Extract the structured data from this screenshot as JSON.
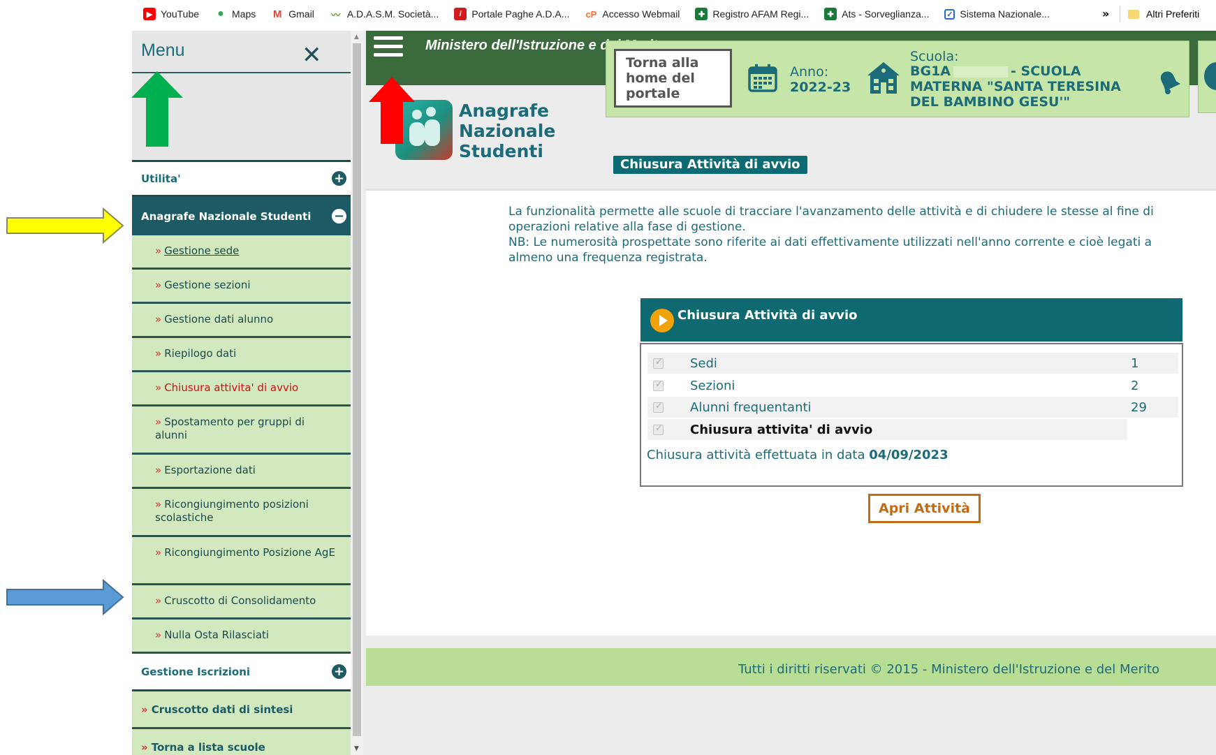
{
  "bookmarks": {
    "items": [
      {
        "label": "YouTube",
        "icon": "youtube-icon",
        "color": "#ff0000"
      },
      {
        "label": "Maps",
        "icon": "maps-icon",
        "color": "#34a853"
      },
      {
        "label": "Gmail",
        "icon": "gmail-icon",
        "color": "#ea4335"
      },
      {
        "label": "A.D.A.S.M. Società...",
        "icon": "chart-icon",
        "color": "#6a9a3a"
      },
      {
        "label": "Portale Paghe A.D.A...",
        "icon": "portale-icon",
        "color": "#d01c1c"
      },
      {
        "label": "Accesso Webmail",
        "icon": "cpanel-icon",
        "color": "#ff6c2c"
      },
      {
        "label": "Registro AFAM Regi...",
        "icon": "registro-icon",
        "color": "#1a7a3a"
      },
      {
        "label": "Ats - Sorveglianza...",
        "icon": "ats-icon",
        "color": "#1a7a3a"
      },
      {
        "label": "Sistema Nazionale...",
        "icon": "checkbox-icon",
        "color": "#2a6ad0"
      }
    ],
    "more": "»",
    "other": "Altri Preferiti"
  },
  "sidebar": {
    "title": "Menu",
    "close": "✕",
    "utilita": "Utilita'",
    "ans": "Anagrafe Nazionale Studenti",
    "items": [
      {
        "label": "Gestione sede"
      },
      {
        "label": "Gestione sezioni"
      },
      {
        "label": "Gestione dati alunno"
      },
      {
        "label": "Riepilogo dati"
      },
      {
        "label": "Chiusura attivita' di avvio"
      },
      {
        "label": "Spostamento per gruppi di alunni"
      },
      {
        "label": "Esportazione dati"
      },
      {
        "label": "Ricongiungimento posizioni scolastiche"
      },
      {
        "label": "Ricongiungimento Posizione AgE"
      },
      {
        "label": "Cruscotto di Consolidamento"
      },
      {
        "label": "Nulla Osta Rilasciati"
      }
    ],
    "raquo": "»",
    "gestione_iscrizioni": "Gestione Iscrizioni",
    "cruscotto": "Cruscotto dati di sintesi",
    "torna_lista": "Torna a lista scuole"
  },
  "header": {
    "ministry": "Ministero dell'Istruzione e del Merito",
    "logo_lines": [
      "Anagrafe",
      "Nazionale",
      "Studenti"
    ],
    "home_button": "Torna alla home del portale",
    "anno_label": "Anno:",
    "anno_value": "2022-23",
    "scuola_label": "Scuola:",
    "scuola_code": "BG1A",
    "scuola_name": "- SCUOLA MATERNA \"SANTA TERESINA DEL BAMBINO GESU'\""
  },
  "page": {
    "title": "Chiusura Attività di avvio",
    "desc": [
      "La funzionalità permette alle scuole di tracciare l'avanzamento delle attività e di chiudere le stesse al fine di",
      "operazioni relative alla fase di gestione.",
      "NB: Le numerosità prospettate sono riferite ai dati effettivamente utilizzati nell'anno corrente e cioè legati a",
      "almeno una frequenza registrata."
    ],
    "panel_title": "Chiusura Attività di avvio",
    "rows": [
      {
        "label": "Sedi",
        "value": "1"
      },
      {
        "label": "Sezioni",
        "value": "2"
      },
      {
        "label": "Alunni frequentanti",
        "value": "29"
      },
      {
        "label": "Chiusura attivita' di avvio",
        "value": ""
      }
    ],
    "closed_text": "Chiusura attività effettuata in data",
    "closed_date": "04/09/2023",
    "reopen_button": "Apri Attività"
  },
  "footer": {
    "text": "Tutti i diritti riservati © 2015 -  Ministero dell'Istruzione e del Merito"
  },
  "colors": {
    "teal": "#1c6b78",
    "dark_green": "#3b6b3d",
    "light_green": "#d2e8bf",
    "active_red": "#d01010",
    "button_orange": "#c26c12"
  }
}
